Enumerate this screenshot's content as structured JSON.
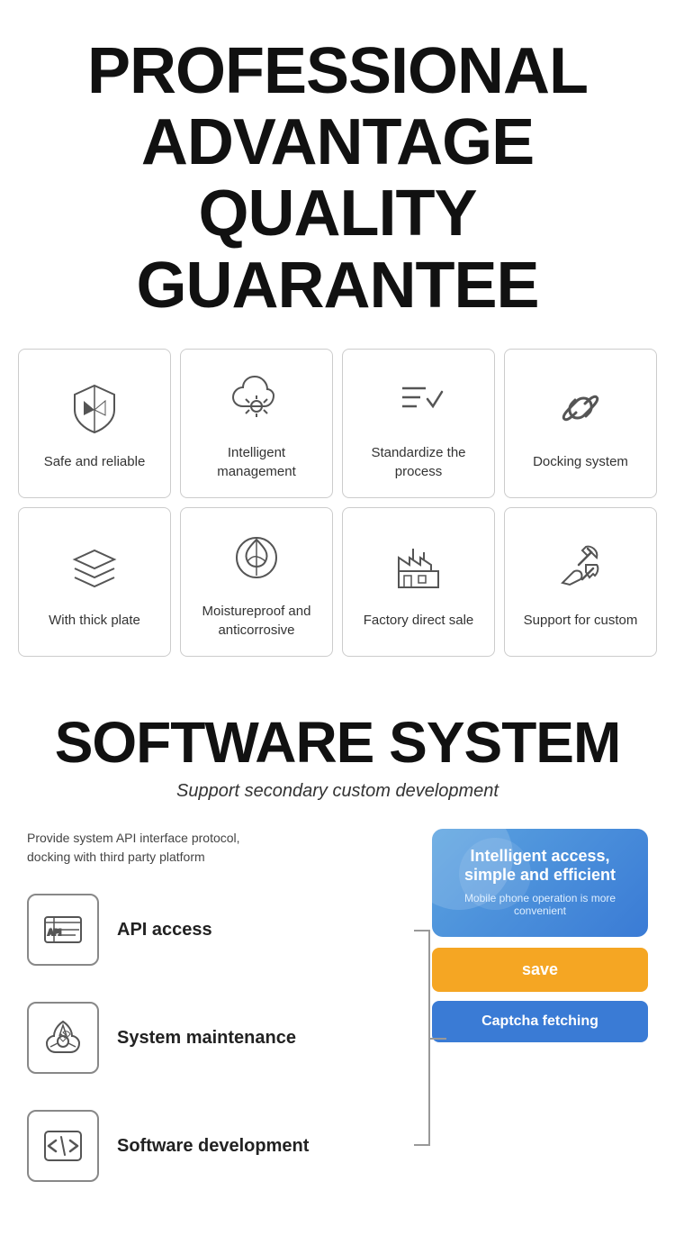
{
  "header": {
    "line1": "PROFESSIONAL",
    "line2": "ADVANTAGE",
    "line3": "QUALITY GUARANTEE"
  },
  "grid": {
    "row1": [
      {
        "id": "safe-reliable",
        "label": "Safe and reliable",
        "icon": "shield"
      },
      {
        "id": "intelligent-management",
        "label": "Intelligent management",
        "icon": "cloud-settings"
      },
      {
        "id": "standardize-process",
        "label": "Standardize the process",
        "icon": "checklist"
      },
      {
        "id": "docking-system",
        "label": "Docking system",
        "icon": "link"
      }
    ],
    "row2": [
      {
        "id": "thick-plate",
        "label": "With thick plate",
        "icon": "layers"
      },
      {
        "id": "moistureproof",
        "label": "Moistureproof and anticorrosive",
        "icon": "leaf-shield"
      },
      {
        "id": "factory-direct",
        "label": "Factory direct sale",
        "icon": "factory"
      },
      {
        "id": "support-custom",
        "label": "Support for custom",
        "icon": "tools"
      }
    ]
  },
  "software": {
    "title": "SOFTWARE SYSTEM",
    "subtitle": "Support secondary custom development",
    "provide_text": "Provide system API interface protocol,\ndocking with third party platform",
    "features": [
      {
        "id": "api-access",
        "label": "API access",
        "icon": "api"
      },
      {
        "id": "system-maintenance",
        "label": "System maintenance",
        "icon": "maintenance"
      },
      {
        "id": "software-development",
        "label": "Software development",
        "icon": "code"
      }
    ],
    "phone_card": {
      "main_text": "Intelligent access, simple and efficient",
      "sub_text": "Mobile phone operation is more convenient"
    },
    "btn_save": "save",
    "btn_captcha": "Captcha fetching"
  }
}
